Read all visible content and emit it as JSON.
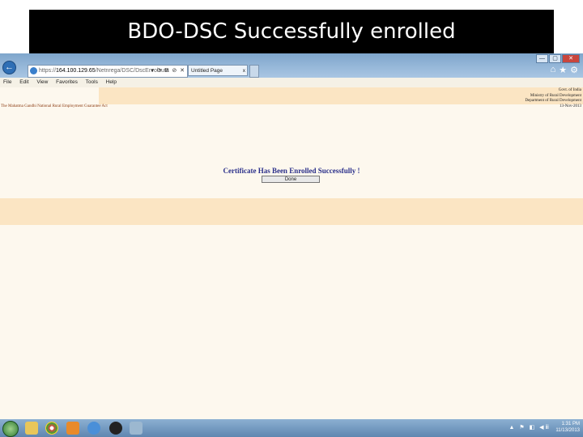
{
  "slide": {
    "title": "BDO-DSC Successfully enrolled"
  },
  "browser": {
    "address_prefix": "https://",
    "address_host": "164.100.129.65",
    "address_path": "/Netnrega/DSC/DscEnrolsuta",
    "address_buttons": "▾ ⟳ B ⊘ ✕",
    "tab_title": "Untitled Page",
    "tab_close": "x",
    "window_controls": [
      "—",
      "▢",
      "✕"
    ],
    "toolbar_icons": [
      "home-icon",
      "star-icon",
      "gear-icon"
    ],
    "menu": [
      "File",
      "Edit",
      "View",
      "Favorites",
      "Tools",
      "Help"
    ]
  },
  "page": {
    "govt_lines": [
      "Govt. of India",
      "Ministry of Rural Development",
      "Department of Rural Development"
    ],
    "subheader_left": "The Mahatma Gandhi National Rural Employment Guarantee Act",
    "date": "13-Nov-2013",
    "message": "Certificate Has Been Enrolled Successfully !",
    "done_label": "Done"
  },
  "taskbar": {
    "time": "1:31 PM",
    "date": "11/13/2013",
    "tray_symbols": "▲ ⚑ ◧ ◀ⅲ"
  },
  "colors": {
    "title_bg": "#000000",
    "page_bg": "#fdf8ee",
    "band": "#fbe5c3",
    "message": "#2a2f8a"
  }
}
